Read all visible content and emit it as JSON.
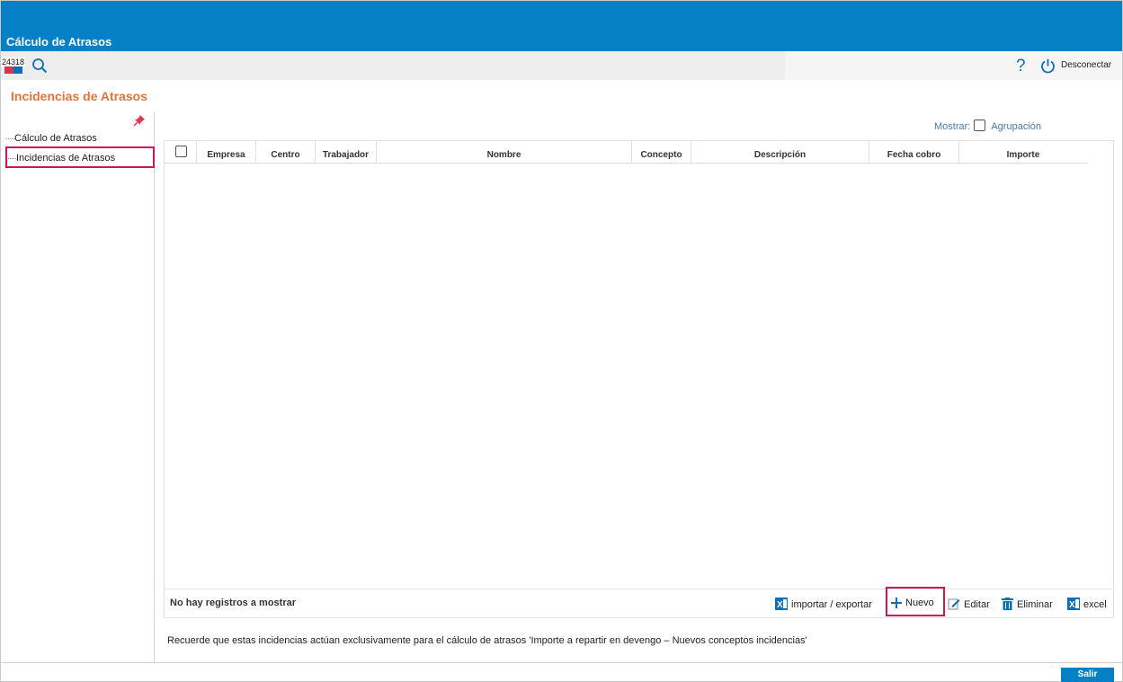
{
  "app": {
    "title": "Cálculo de Atrasos",
    "badge_text": "24318"
  },
  "toolbar": {
    "help_label": "?",
    "disconnect_label": "Desconectar"
  },
  "page": {
    "title": "Incidencias de Atrasos"
  },
  "sidebar": {
    "items": [
      {
        "label": "Cálculo de Atrasos",
        "selected": false
      },
      {
        "label": "Incidencias de Atrasos",
        "selected": true
      }
    ]
  },
  "options": {
    "show_label": "Mostrar:",
    "grouping_label": "Agrupación",
    "grouping_checked": false
  },
  "grid": {
    "columns": [
      "Empresa",
      "Centro",
      "Trabajador",
      "Nombre",
      "Concepto",
      "Descripción",
      "Fecha cobro",
      "Importe"
    ],
    "rows": [],
    "empty_message": "No hay registros a mostrar"
  },
  "actions": {
    "import_export": "importar / exportar",
    "new": "Nuevo",
    "edit": "Editar",
    "delete": "Eliminar",
    "excel": "excel"
  },
  "note": "Recuerde que estas incidencias actúan exclusivamente para el cálculo de atrasos 'Importe a repartir en devengo – Nuevos conceptos incidencias'",
  "footer": {
    "exit_label": "Salir"
  },
  "colors": {
    "primary": "#0380c6",
    "title_orange": "#e1743b",
    "highlight": "#d0145a",
    "link": "#4a7aa8"
  }
}
